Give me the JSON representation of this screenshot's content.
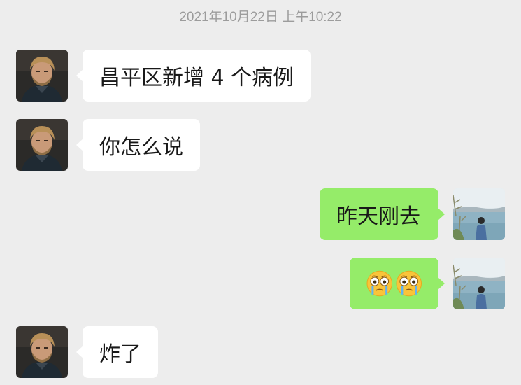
{
  "chat": {
    "timestamp": "2021年10月22日 上午10:22",
    "messages": [
      {
        "sender": "friend",
        "text": "昌平区新增 4 个病例"
      },
      {
        "sender": "friend",
        "text": "你怎么说"
      },
      {
        "sender": "me",
        "text": "昨天刚去"
      },
      {
        "sender": "me",
        "emoji": [
          "crying-face-emoji",
          "crying-face-emoji"
        ]
      },
      {
        "sender": "friend",
        "text": "炸了"
      }
    ]
  },
  "colors": {
    "background": "#ededed",
    "incoming_bubble": "#ffffff",
    "outgoing_bubble": "#95ec69",
    "timestamp_text": "#9c9c9c",
    "message_text": "#191919"
  },
  "icons": {
    "friend_avatar": "bearded-man-avatar",
    "my_avatar": "lakeside-person-avatar"
  }
}
